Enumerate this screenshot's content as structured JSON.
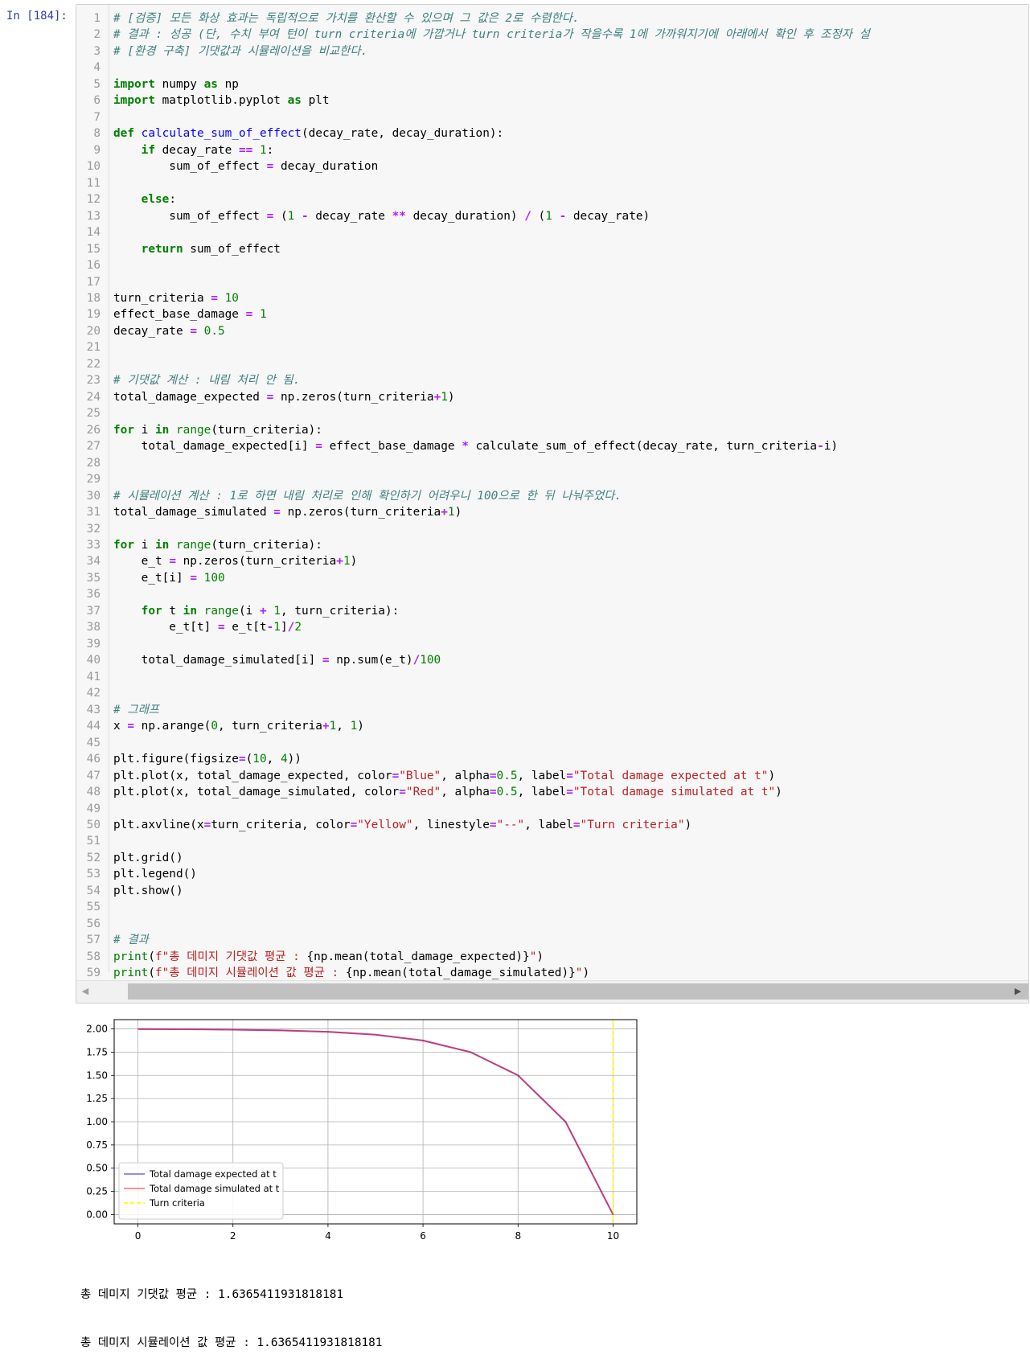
{
  "prompt": "In [184]:",
  "code_lines": [
    {
      "n": "1",
      "html": "<span class=\"cm\"># [검증] 모든 화상 효과는 독립적으로 가치를 환산할 수 있으며 그 값은 2로 수렴한다.</span>"
    },
    {
      "n": "2",
      "html": "<span class=\"cm\"># 결과 : 성공 (단, 수치 부여 턴이 turn criteria에 가깝거나 turn criteria가 작을수록 1에 가까워지기에 아래에서 확인 후 조정자 설</span>"
    },
    {
      "n": "3",
      "html": "<span class=\"cm\"># [환경 구축] 기댓값과 시뮬레이션을 비교한다.</span>"
    },
    {
      "n": "4",
      "html": ""
    },
    {
      "n": "5",
      "html": "<span class=\"kw\">import</span> numpy <span class=\"kw\">as</span> np"
    },
    {
      "n": "6",
      "html": "<span class=\"kw\">import</span> matplotlib.pyplot <span class=\"kw\">as</span> plt"
    },
    {
      "n": "7",
      "html": ""
    },
    {
      "n": "8",
      "html": "<span class=\"kw\">def</span> <span class=\"fn\">calculate_sum_of_effect</span>(decay_rate, decay_duration):"
    },
    {
      "n": "9",
      "html": "    <span class=\"kw\">if</span> decay_rate <span class=\"op\">==</span> <span class=\"num\">1</span>:"
    },
    {
      "n": "10",
      "html": "        sum_of_effect <span class=\"op\">=</span> decay_duration"
    },
    {
      "n": "11",
      "html": ""
    },
    {
      "n": "12",
      "html": "    <span class=\"kw\">else</span>:"
    },
    {
      "n": "13",
      "html": "        sum_of_effect <span class=\"op\">=</span> (<span class=\"num\">1</span> <span class=\"op\">-</span> decay_rate <span class=\"op\">**</span> decay_duration) <span class=\"op\">/</span> (<span class=\"num\">1</span> <span class=\"op\">-</span> decay_rate)"
    },
    {
      "n": "14",
      "html": ""
    },
    {
      "n": "15",
      "html": "    <span class=\"kw\">return</span> sum_of_effect"
    },
    {
      "n": "16",
      "html": ""
    },
    {
      "n": "17",
      "html": ""
    },
    {
      "n": "18",
      "html": "turn_criteria <span class=\"op\">=</span> <span class=\"num\">10</span>"
    },
    {
      "n": "19",
      "html": "effect_base_damage <span class=\"op\">=</span> <span class=\"num\">1</span>"
    },
    {
      "n": "20",
      "html": "decay_rate <span class=\"op\">=</span> <span class=\"num\">0.5</span>"
    },
    {
      "n": "21",
      "html": ""
    },
    {
      "n": "22",
      "html": ""
    },
    {
      "n": "23",
      "html": "<span class=\"cm\"># 기댓값 계산 : 내림 처리 안 됨.</span>"
    },
    {
      "n": "24",
      "html": "total_damage_expected <span class=\"op\">=</span> np.zeros(turn_criteria<span class=\"op\">+</span><span class=\"num\">1</span>)"
    },
    {
      "n": "25",
      "html": ""
    },
    {
      "n": "26",
      "html": "<span class=\"kw\">for</span> i <span class=\"kw\">in</span> <span class=\"nb\">range</span>(turn_criteria):"
    },
    {
      "n": "27",
      "html": "    total_damage_expected[i] <span class=\"op\">=</span> effect_base_damage <span class=\"op\">*</span> calculate_sum_of_effect(decay_rate, turn_criteria<span class=\"op\">-</span>i)"
    },
    {
      "n": "28",
      "html": ""
    },
    {
      "n": "29",
      "html": ""
    },
    {
      "n": "30",
      "html": "<span class=\"cm\"># 시뮬레이션 계산 : 1로 하면 내림 처리로 인해 확인하기 어려우니 100으로 한 뒤 나눠주었다.</span>"
    },
    {
      "n": "31",
      "html": "total_damage_simulated <span class=\"op\">=</span> np.zeros(turn_criteria<span class=\"op\">+</span><span class=\"num\">1</span>)"
    },
    {
      "n": "32",
      "html": ""
    },
    {
      "n": "33",
      "html": "<span class=\"kw\">for</span> i <span class=\"kw\">in</span> <span class=\"nb\">range</span>(turn_criteria):"
    },
    {
      "n": "34",
      "html": "    e_t <span class=\"op\">=</span> np.zeros(turn_criteria<span class=\"op\">+</span><span class=\"num\">1</span>)"
    },
    {
      "n": "35",
      "html": "    e_t[i] <span class=\"op\">=</span> <span class=\"num\">100</span>"
    },
    {
      "n": "36",
      "html": ""
    },
    {
      "n": "37",
      "html": "    <span class=\"kw\">for</span> t <span class=\"kw\">in</span> <span class=\"nb\">range</span>(i <span class=\"op\">+</span> <span class=\"num\">1</span>, turn_criteria):"
    },
    {
      "n": "38",
      "html": "        e_t[t] <span class=\"op\">=</span> e_t[t<span class=\"op\">-</span><span class=\"num\">1</span>]<span class=\"op\">/</span><span class=\"num\">2</span>"
    },
    {
      "n": "39",
      "html": ""
    },
    {
      "n": "40",
      "html": "    total_damage_simulated[i] <span class=\"op\">=</span> np.sum(e_t)<span class=\"op\">/</span><span class=\"num\">100</span>"
    },
    {
      "n": "41",
      "html": ""
    },
    {
      "n": "42",
      "html": ""
    },
    {
      "n": "43",
      "html": "<span class=\"cm\"># 그래프</span>"
    },
    {
      "n": "44",
      "html": "x <span class=\"op\">=</span> np.arange(<span class=\"num\">0</span>, turn_criteria<span class=\"op\">+</span><span class=\"num\">1</span>, <span class=\"num\">1</span>)"
    },
    {
      "n": "45",
      "html": ""
    },
    {
      "n": "46",
      "html": "plt.figure(figsize<span class=\"op\">=</span>(<span class=\"num\">10</span>, <span class=\"num\">4</span>))"
    },
    {
      "n": "47",
      "html": "plt.plot(x, total_damage_expected, color<span class=\"op\">=</span><span class=\"str\">\"Blue\"</span>, alpha<span class=\"op\">=</span><span class=\"num\">0.5</span>, label<span class=\"op\">=</span><span class=\"str\">\"Total damage expected at t\"</span>)"
    },
    {
      "n": "48",
      "html": "plt.plot(x, total_damage_simulated, color<span class=\"op\">=</span><span class=\"str\">\"Red\"</span>, alpha<span class=\"op\">=</span><span class=\"num\">0.5</span>, label<span class=\"op\">=</span><span class=\"str\">\"Total damage simulated at t\"</span>)"
    },
    {
      "n": "49",
      "html": ""
    },
    {
      "n": "50",
      "html": "plt.axvline(x<span class=\"op\">=</span>turn_criteria, color<span class=\"op\">=</span><span class=\"str\">\"Yellow\"</span>, linestyle<span class=\"op\">=</span><span class=\"str\">\"--\"</span>, label<span class=\"op\">=</span><span class=\"str\">\"Turn criteria\"</span>)"
    },
    {
      "n": "51",
      "html": ""
    },
    {
      "n": "52",
      "html": "plt.grid()"
    },
    {
      "n": "53",
      "html": "plt.legend()"
    },
    {
      "n": "54",
      "html": "plt.show()"
    },
    {
      "n": "55",
      "html": ""
    },
    {
      "n": "56",
      "html": ""
    },
    {
      "n": "57",
      "html": "<span class=\"cm\"># 결과</span>"
    },
    {
      "n": "58",
      "html": "<span class=\"nb\">print</span>(<span class=\"str\">f\"총 데미지 기댓값 평균 : </span>{np.mean(total_damage_expected)}<span class=\"str\">\"</span>)"
    },
    {
      "n": "59",
      "html": "<span class=\"nb\">print</span>(<span class=\"str\">f\"총 데미지 시뮬레이션 값 평균 : </span>{np.mean(total_damage_simulated)}<span class=\"str\">\"</span>)"
    }
  ],
  "chart_data": {
    "type": "line",
    "x": [
      0,
      1,
      2,
      3,
      4,
      5,
      6,
      7,
      8,
      9,
      10
    ],
    "series": [
      {
        "name": "Total damage expected at t",
        "color": "#0000ff",
        "alpha": 0.5,
        "values": [
          1.998046875,
          1.99609375,
          1.9921875,
          1.984375,
          1.96875,
          1.9375,
          1.875,
          1.75,
          1.5,
          1.0,
          0.0
        ]
      },
      {
        "name": "Total damage simulated at t",
        "color": "#ff0000",
        "alpha": 0.5,
        "values": [
          1.998046875,
          1.99609375,
          1.9921875,
          1.984375,
          1.96875,
          1.9375,
          1.875,
          1.75,
          1.5,
          1.0,
          0.0
        ]
      }
    ],
    "vline": {
      "name": "Turn criteria",
      "x": 10,
      "color": "#ffff00",
      "linestyle": "dashed"
    },
    "xticks": [
      0,
      2,
      4,
      6,
      8,
      10
    ],
    "yticks": [
      "0.00",
      "0.25",
      "0.50",
      "0.75",
      "1.00",
      "1.25",
      "1.50",
      "1.75",
      "2.00"
    ],
    "xlim": [
      -0.5,
      10.5
    ],
    "ylim": [
      -0.1,
      2.1
    ],
    "grid": true,
    "legend": "lower-left"
  },
  "output_lines": [
    "총 데미지 기댓값 평균 : 1.6365411931818181",
    "총 데미지 시뮬레이션 값 평균 : 1.6365411931818181"
  ],
  "scroll_left_glyph": "◀",
  "scroll_right_glyph": "▶"
}
